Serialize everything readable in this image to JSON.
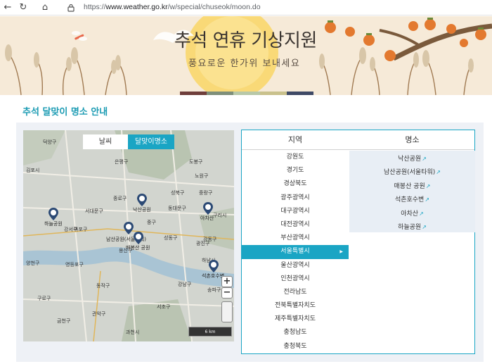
{
  "browser": {
    "url_prefix": "https://",
    "url_host": "www.weather.go.kr",
    "url_path": "/w/special/chuseok/moon.do"
  },
  "banner": {
    "title": "추석 연휴 기상지원",
    "subtitle": "풍요로운 한가위 보내세요",
    "colors": [
      "#6f3e3b",
      "#7f8f7a",
      "#b8c8a8",
      "#c9c18c",
      "#3f4a66",
      "#9a6a6e"
    ]
  },
  "section": {
    "title": "추석 달맞이 명소 안내"
  },
  "map": {
    "toggle_weather": "날씨",
    "toggle_moon": "달맞이명소",
    "scale": "6 km",
    "zoom_in": "+",
    "zoom_out": "−",
    "districts": [
      "덕양구",
      "은평구",
      "도봉구",
      "노원구",
      "구리시",
      "성북구",
      "종로구",
      "서대문구",
      "마포구",
      "중구",
      "동대문구",
      "중랑구",
      "광진구",
      "성동구",
      "용산구",
      "영등포구",
      "양천구",
      "동작구",
      "관악구",
      "서초구",
      "강남구",
      "송파구",
      "강동구",
      "구로구",
      "금천구",
      "하남시",
      "과천시",
      "강서구",
      "김포시"
    ],
    "pins": [
      "하늘공원",
      "낙산공원",
      "남산공원(서울타워)",
      "매봉산 공원",
      "아차산",
      "석촌호수변"
    ]
  },
  "table": {
    "col_region": "지역",
    "col_place": "명소",
    "regions": [
      "강원도",
      "경기도",
      "경상북도",
      "광주광역시",
      "대구광역시",
      "대전광역시",
      "부산광역시",
      "서울특별시",
      "울산광역시",
      "인천광역시",
      "전라남도",
      "전북특별자치도",
      "제주특별자치도",
      "충청남도",
      "충청북도"
    ],
    "active_region": "서울특별시",
    "places": [
      "낙산공원",
      "남산공원(서울타워)",
      "매봉산 공원",
      "석촌호수변",
      "아차산",
      "하늘공원"
    ]
  }
}
